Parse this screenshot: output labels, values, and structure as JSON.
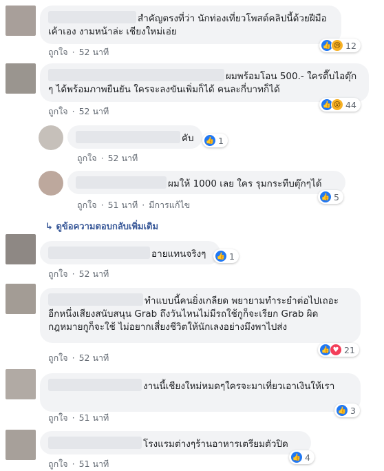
{
  "comments": [
    {
      "text": "สำคัญตรงที่ว่า นักท่องเที่ยวโพสต์คลิปนี้ด้วยฝีมือเค้าเอง งามหน้าล่ะ เชียงใหม่เอ่ย",
      "like": "ถูกใจ",
      "time": "52 นาที",
      "reaction_count": "12"
    },
    {
      "text": "ผมพร้อมโอน 500.- ใครตื๊บไอตุ๊ก ๆ ได้พร้อมภาพยืนยัน ใครจะลงขันเพิ่มก็ได้ คนละกี่บาทก็ได้",
      "like": "ถูกใจ",
      "time": "52 นาที",
      "reaction_count": "44"
    },
    {
      "text": "คับ",
      "like": "ถูกใจ",
      "time": "52 นาที",
      "reaction_count": "1"
    },
    {
      "text": "ผมให้ 1000 เลย ใคร รุมกระทืบตุ๊กๆได้",
      "like": "ถูกใจ",
      "time": "51 นาที",
      "edited": "มีการแก้ไข",
      "reaction_count": "5"
    },
    {
      "text": "อายแทนจริงๆ",
      "like": "ถูกใจ",
      "time": "52 นาที",
      "reaction_count": "1"
    },
    {
      "text": "ทำแบบนี้คนยิ่งเกลียด พยายามทำระยำต่อไปเถอะ อีกหนึ่งเสียงสนับสนุน Grab ถึงวันไหนไม่มีรถใช้กูก็จะเรียก Grab ผิดกฎหมายกูก็จะใช้ ไม่อยากเสี่ยงชีวิตให้นักเลงอย่างมึงพาไปส่ง",
      "like": "ถูกใจ",
      "time": "52 นาที",
      "reaction_count": "21"
    },
    {
      "text": "งานนี้เชียงใหม่หมดๆใครจะมาเที่ยวเอาเงินให้เรา",
      "like": "ถูกใจ",
      "time": "51 นาที",
      "reaction_count": "3"
    },
    {
      "text": "โรงแรมต่างๆร้านอาหารเตรียมตัวปิด",
      "like": "ถูกใจ",
      "time": "51 นาที",
      "reaction_count": "4"
    }
  ],
  "more_replies": "ดูข้อความตอบกลับเพิ่มเติม",
  "colors": {
    "like": "#2078f4",
    "heart": "#f33e58",
    "bubble": "#f2f3f5",
    "link": "#385898"
  }
}
